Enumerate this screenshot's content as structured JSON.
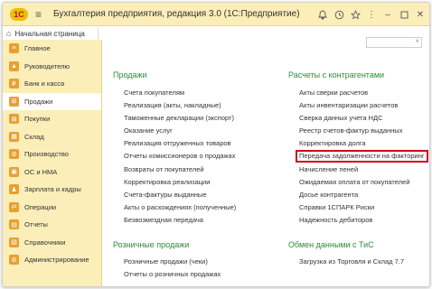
{
  "titlebar": {
    "logo": "1С",
    "title": "Бухгалтерия предприятия, редакция 3.0  (1С:Предприятие)"
  },
  "home_tab": {
    "label": "Начальная страница"
  },
  "sidebar": {
    "items": [
      {
        "label": "Главное",
        "icon": "home-icon",
        "color": "#f0a030"
      },
      {
        "label": "Руководителю",
        "icon": "chart-icon",
        "color": "#f0a030"
      },
      {
        "label": "Банк и касса",
        "icon": "bank-icon",
        "color": "#f0a030"
      },
      {
        "label": "Продажи",
        "icon": "cart-icon",
        "color": "#f0a030"
      },
      {
        "label": "Покупки",
        "icon": "basket-icon",
        "color": "#f0a030"
      },
      {
        "label": "Склад",
        "icon": "warehouse-icon",
        "color": "#f0a030"
      },
      {
        "label": "Производство",
        "icon": "factory-icon",
        "color": "#f0a030"
      },
      {
        "label": "ОС и НМА",
        "icon": "assets-icon",
        "color": "#f0a030"
      },
      {
        "label": "Зарплата и кадры",
        "icon": "people-icon",
        "color": "#f0a030"
      },
      {
        "label": "Операции",
        "icon": "operations-icon",
        "color": "#f0a030"
      },
      {
        "label": "Отчеты",
        "icon": "reports-icon",
        "color": "#f0a030"
      },
      {
        "label": "Справочники",
        "icon": "book-icon",
        "color": "#f0a030"
      },
      {
        "label": "Администрирование",
        "icon": "gear-icon",
        "color": "#f0a030"
      }
    ],
    "active_index": 3
  },
  "main": {
    "sales": {
      "title": "Продажи",
      "links": [
        "Счета покупателям",
        "Реализация (акты, накладные)",
        "Таможенные декларации (экспорт)",
        "Оказание услуг",
        "Реализация отгруженных товаров",
        "Отчеты комиссионеров о продажах",
        "Возвраты от покупателей",
        "Корректировка реализации",
        "Счета-фактуры выданные",
        "Акты о расхождениях (полученные)",
        "Безвозмездная передача"
      ]
    },
    "retail": {
      "title": "Розничные продажи",
      "links": [
        "Розничные продажи (чеки)",
        "Отчеты о розничных продажах"
      ]
    },
    "settlements": {
      "title": "Расчеты с контрагентами",
      "links": [
        "Акты сверки расчетов",
        "Акты инвентаризации расчетов",
        "Сверка данных учета НДС",
        "Реестр счетов-фактур выданных",
        "Корректировка долга",
        "Передача задолженности на факторинг",
        "Начисление пеней",
        "Ожидаемая оплата от покупателей",
        "Досье контрагента",
        "Справки 1СПАРК Риски",
        "Надежность дебиторов"
      ],
      "highlighted_index": 5,
      "highlight_color": "#d0021b"
    },
    "exchange": {
      "title": "Обмен данными с ТиС",
      "links": [
        "Загрузка из Торговля и Склад 7.7"
      ]
    }
  },
  "colors": {
    "accent": "#fbeeb8",
    "section_title": "#2e8b3a"
  }
}
